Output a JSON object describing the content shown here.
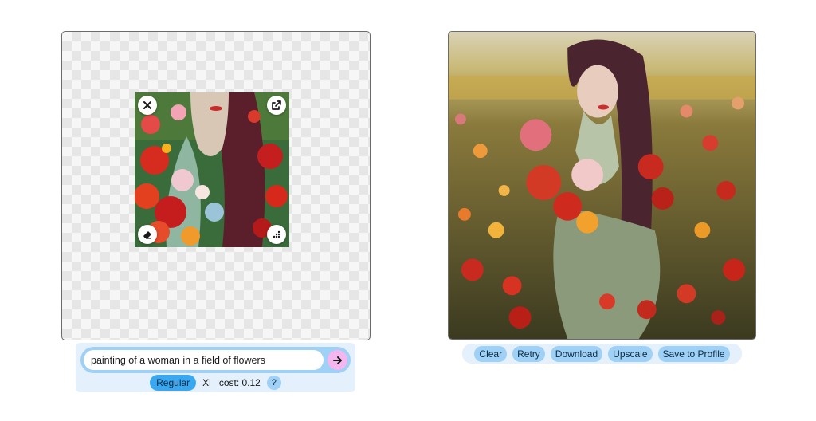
{
  "editor": {
    "close_icon": "close-icon",
    "open_icon": "open-external-icon",
    "erase_icon": "eraser-icon",
    "scatter_icon": "scatter-dots-icon"
  },
  "prompt": {
    "value": "painting of a woman in a field of flowers",
    "send_icon": "arrow-right-icon"
  },
  "options": {
    "regular_label": "Regular",
    "xl_label": "Xl",
    "cost_label": "cost: 0.12",
    "help_label": "?"
  },
  "actions": [
    "Clear",
    "Retry",
    "Download",
    "Upscale",
    "Save to Profile"
  ],
  "colors": {
    "accent": "#3aa8f0",
    "pill": "#9fd0f6",
    "panel": "#e4f0fb",
    "send": "#f5b6ef"
  }
}
